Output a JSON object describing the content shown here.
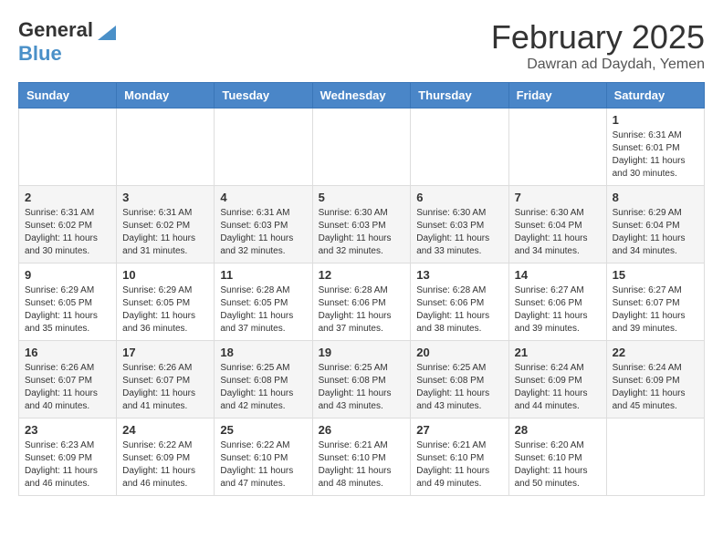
{
  "header": {
    "logo_general": "General",
    "logo_blue": "Blue",
    "month_year": "February 2025",
    "location": "Dawran ad Daydah, Yemen"
  },
  "weekdays": [
    "Sunday",
    "Monday",
    "Tuesday",
    "Wednesday",
    "Thursday",
    "Friday",
    "Saturday"
  ],
  "weeks": [
    [
      {
        "day": "",
        "info": ""
      },
      {
        "day": "",
        "info": ""
      },
      {
        "day": "",
        "info": ""
      },
      {
        "day": "",
        "info": ""
      },
      {
        "day": "",
        "info": ""
      },
      {
        "day": "",
        "info": ""
      },
      {
        "day": "1",
        "info": "Sunrise: 6:31 AM\nSunset: 6:01 PM\nDaylight: 11 hours and 30 minutes."
      }
    ],
    [
      {
        "day": "2",
        "info": "Sunrise: 6:31 AM\nSunset: 6:02 PM\nDaylight: 11 hours and 30 minutes."
      },
      {
        "day": "3",
        "info": "Sunrise: 6:31 AM\nSunset: 6:02 PM\nDaylight: 11 hours and 31 minutes."
      },
      {
        "day": "4",
        "info": "Sunrise: 6:31 AM\nSunset: 6:03 PM\nDaylight: 11 hours and 32 minutes."
      },
      {
        "day": "5",
        "info": "Sunrise: 6:30 AM\nSunset: 6:03 PM\nDaylight: 11 hours and 32 minutes."
      },
      {
        "day": "6",
        "info": "Sunrise: 6:30 AM\nSunset: 6:03 PM\nDaylight: 11 hours and 33 minutes."
      },
      {
        "day": "7",
        "info": "Sunrise: 6:30 AM\nSunset: 6:04 PM\nDaylight: 11 hours and 34 minutes."
      },
      {
        "day": "8",
        "info": "Sunrise: 6:29 AM\nSunset: 6:04 PM\nDaylight: 11 hours and 34 minutes."
      }
    ],
    [
      {
        "day": "9",
        "info": "Sunrise: 6:29 AM\nSunset: 6:05 PM\nDaylight: 11 hours and 35 minutes."
      },
      {
        "day": "10",
        "info": "Sunrise: 6:29 AM\nSunset: 6:05 PM\nDaylight: 11 hours and 36 minutes."
      },
      {
        "day": "11",
        "info": "Sunrise: 6:28 AM\nSunset: 6:05 PM\nDaylight: 11 hours and 37 minutes."
      },
      {
        "day": "12",
        "info": "Sunrise: 6:28 AM\nSunset: 6:06 PM\nDaylight: 11 hours and 37 minutes."
      },
      {
        "day": "13",
        "info": "Sunrise: 6:28 AM\nSunset: 6:06 PM\nDaylight: 11 hours and 38 minutes."
      },
      {
        "day": "14",
        "info": "Sunrise: 6:27 AM\nSunset: 6:06 PM\nDaylight: 11 hours and 39 minutes."
      },
      {
        "day": "15",
        "info": "Sunrise: 6:27 AM\nSunset: 6:07 PM\nDaylight: 11 hours and 39 minutes."
      }
    ],
    [
      {
        "day": "16",
        "info": "Sunrise: 6:26 AM\nSunset: 6:07 PM\nDaylight: 11 hours and 40 minutes."
      },
      {
        "day": "17",
        "info": "Sunrise: 6:26 AM\nSunset: 6:07 PM\nDaylight: 11 hours and 41 minutes."
      },
      {
        "day": "18",
        "info": "Sunrise: 6:25 AM\nSunset: 6:08 PM\nDaylight: 11 hours and 42 minutes."
      },
      {
        "day": "19",
        "info": "Sunrise: 6:25 AM\nSunset: 6:08 PM\nDaylight: 11 hours and 43 minutes."
      },
      {
        "day": "20",
        "info": "Sunrise: 6:25 AM\nSunset: 6:08 PM\nDaylight: 11 hours and 43 minutes."
      },
      {
        "day": "21",
        "info": "Sunrise: 6:24 AM\nSunset: 6:09 PM\nDaylight: 11 hours and 44 minutes."
      },
      {
        "day": "22",
        "info": "Sunrise: 6:24 AM\nSunset: 6:09 PM\nDaylight: 11 hours and 45 minutes."
      }
    ],
    [
      {
        "day": "23",
        "info": "Sunrise: 6:23 AM\nSunset: 6:09 PM\nDaylight: 11 hours and 46 minutes."
      },
      {
        "day": "24",
        "info": "Sunrise: 6:22 AM\nSunset: 6:09 PM\nDaylight: 11 hours and 46 minutes."
      },
      {
        "day": "25",
        "info": "Sunrise: 6:22 AM\nSunset: 6:10 PM\nDaylight: 11 hours and 47 minutes."
      },
      {
        "day": "26",
        "info": "Sunrise: 6:21 AM\nSunset: 6:10 PM\nDaylight: 11 hours and 48 minutes."
      },
      {
        "day": "27",
        "info": "Sunrise: 6:21 AM\nSunset: 6:10 PM\nDaylight: 11 hours and 49 minutes."
      },
      {
        "day": "28",
        "info": "Sunrise: 6:20 AM\nSunset: 6:10 PM\nDaylight: 11 hours and 50 minutes."
      },
      {
        "day": "",
        "info": ""
      }
    ]
  ]
}
